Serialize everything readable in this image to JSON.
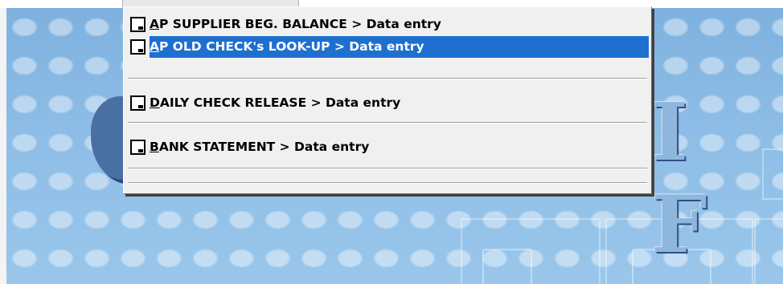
{
  "menu": {
    "items": [
      {
        "accel": "A",
        "rest": "P SUPPLIER BEG. BALANCE > Data entry",
        "icon": "document-icon",
        "highlighted": false
      },
      {
        "accel": "A",
        "rest": "P OLD CHECK's LOOK-UP > Data entry",
        "icon": "document-icon",
        "highlighted": true
      },
      {
        "accel": "D",
        "rest": "AILY CHECK RELEASE > Data entry",
        "icon": "document-icon",
        "highlighted": false
      },
      {
        "accel": "B",
        "rest": "ANK STATEMENT > Data entry",
        "icon": "document-icon",
        "highlighted": false
      }
    ]
  },
  "colors": {
    "highlight": "#1e6fd0",
    "menu_background": "#f0f0f0",
    "backdrop": "#86b7e2"
  }
}
